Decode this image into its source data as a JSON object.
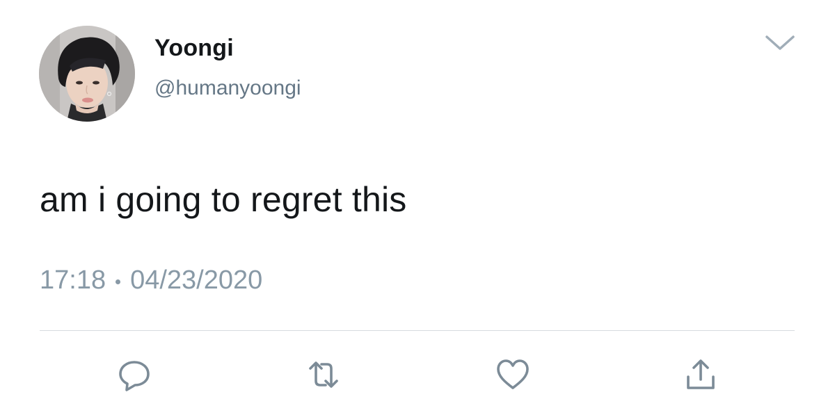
{
  "tweet": {
    "display_name": "Yoongi",
    "handle": "@humanyoongi",
    "text": "am i going to regret this",
    "time": "17:18",
    "date": "04/23/2020"
  },
  "icons": {
    "avatar": "profile-photo",
    "menu": "chevron-down-icon",
    "reply": "reply-icon",
    "retweet": "retweet-icon",
    "like": "heart-icon",
    "share": "share-icon"
  },
  "colors": {
    "primary_text": "#14171a",
    "secondary_text": "#657786",
    "meta_text": "#8899a6",
    "icon_gray": "#7c8b97",
    "divider": "#d6dbdf"
  }
}
